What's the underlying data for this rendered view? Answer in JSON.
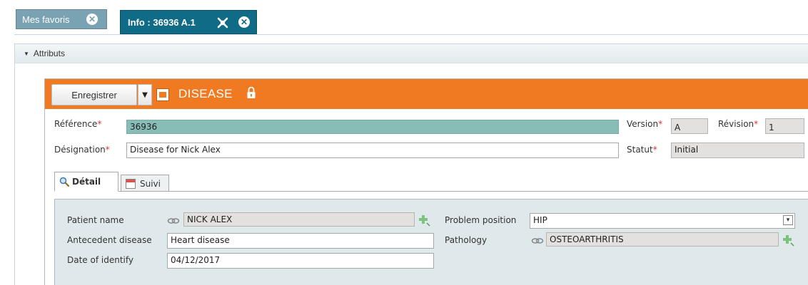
{
  "tabs": {
    "favorites": {
      "label": "Mes favoris"
    },
    "info": {
      "label": "Info : 36936 A.1"
    }
  },
  "section": {
    "title": "Attributs"
  },
  "toolbar": {
    "save_label": "Enregistrer",
    "object_type": "DISEASE",
    "color": "#f07a21"
  },
  "header_fields": {
    "reference": {
      "label": "Référence",
      "required_mark": "*",
      "value": "36936"
    },
    "designation": {
      "label": "Désignation",
      "required_mark": "*",
      "value": "Disease for Nick Alex"
    },
    "version": {
      "label": "Version",
      "required_mark": "*",
      "value": "A"
    },
    "revision": {
      "label": "Révision",
      "required_mark": "*",
      "value": "1"
    },
    "status": {
      "label": "Statut",
      "required_mark": "*",
      "value": "Initial"
    }
  },
  "subtabs": [
    {
      "label": "Détail",
      "icon": "magnifier-icon",
      "active": true
    },
    {
      "label": "Suivi",
      "icon": "calendar-icon",
      "active": false
    }
  ],
  "detail": {
    "patient_name": {
      "label": "Patient name",
      "value": "NICK ALEX"
    },
    "antecedent_disease": {
      "label": "Antecedent disease",
      "value": "Heart disease"
    },
    "date_of_identify": {
      "label": "Date of identify",
      "value": "04/12/2017"
    },
    "problem_position": {
      "label": "Problem position",
      "value": "HIP"
    },
    "pathology": {
      "label": "Pathology",
      "value": "OSTEOARTHRITIS"
    }
  }
}
